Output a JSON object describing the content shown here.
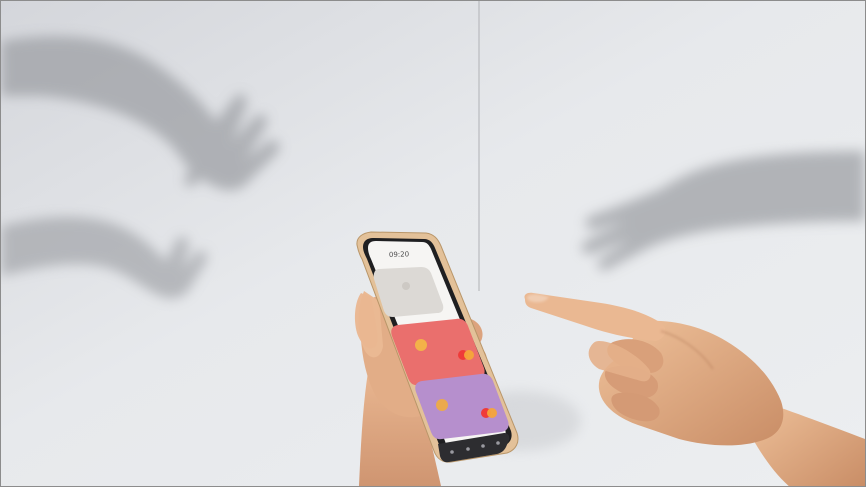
{
  "image": {
    "subject": "shadow-hands-and-smartphone-with-cards",
    "phone": {
      "status_time": "09:20",
      "cards": [
        {
          "name": "grey-card",
          "color": "#d9d6d3"
        },
        {
          "name": "red-card",
          "color": "#ea6f6d"
        },
        {
          "name": "purple-card",
          "color": "#b68fcd"
        }
      ],
      "nav_bar_color": "#2d2d30"
    },
    "colors": {
      "wall": "#e4e6ea",
      "wall_shadow": "#a7a9ae",
      "skin": "#e6b48d",
      "skin_shadow": "#b47b5a",
      "phone_frame": "#e8c9a2"
    }
  }
}
